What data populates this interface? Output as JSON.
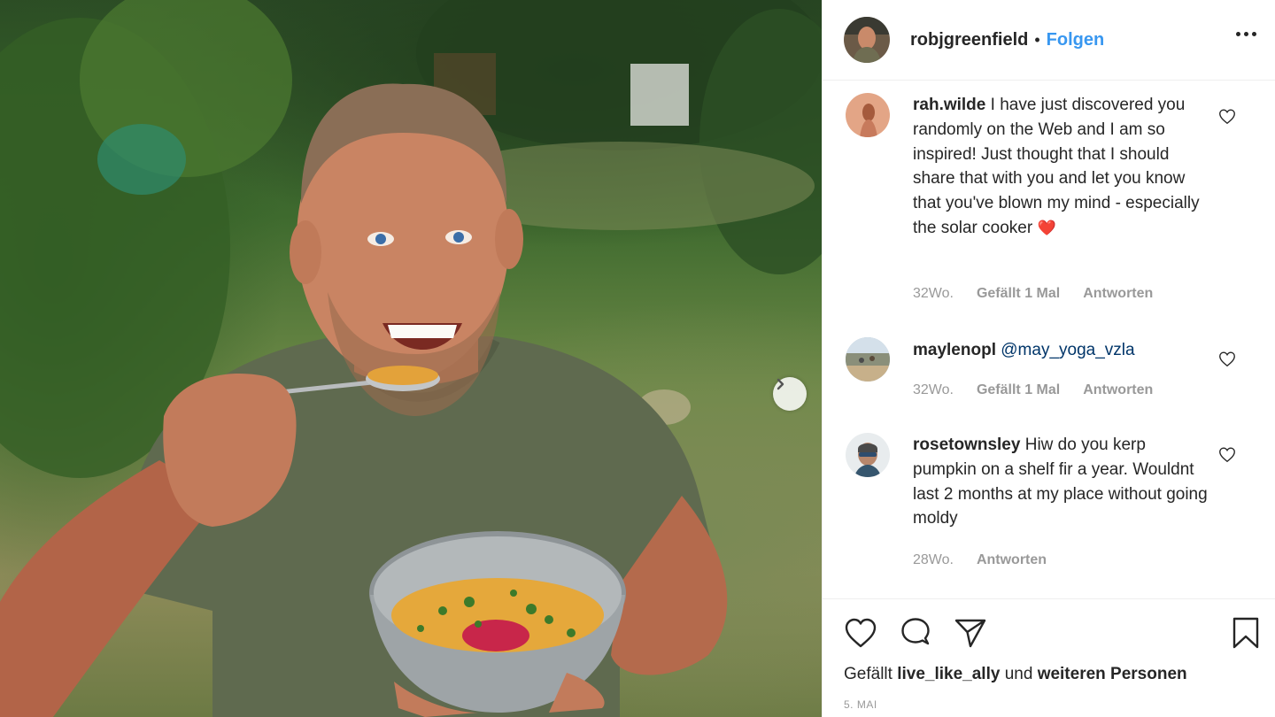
{
  "post": {
    "username": "robjgreenfield",
    "separator": "•",
    "follow_label": "Folgen",
    "more_icon": "more-horizontal-icon"
  },
  "comments": [
    {
      "username": "rah.wilde",
      "text": "I have just discovered you randomly on the Web and I am so inspired! Just thought that I should share that with you and let you know that you've blown my mind - especially the solar cooker",
      "emoji": "❤️",
      "time": "32Wo.",
      "likes": "Gefällt 1 Mal",
      "reply": "Antworten"
    },
    {
      "username": "maylenopl",
      "mention": "@may_yoga_vzla",
      "time": "32Wo.",
      "likes": "Gefällt 1 Mal",
      "reply": "Antworten"
    },
    {
      "username": "rosetownsley",
      "text": "Hiw do you kerp pumpkin on a shelf fir a year. Wouldnt last 2 months at my place without going moldy",
      "time": "28Wo.",
      "reply": "Antworten"
    }
  ],
  "footer": {
    "liked_prefix": "Gefällt",
    "liked_user": "live_like_ally",
    "liked_mid": "und",
    "liked_others": "weiteren Personen",
    "date": "5. MAI"
  },
  "colors": {
    "link_blue": "#3897f0",
    "mention_blue": "#003569",
    "meta_gray": "#999999",
    "heart_red": "#ed4956"
  }
}
